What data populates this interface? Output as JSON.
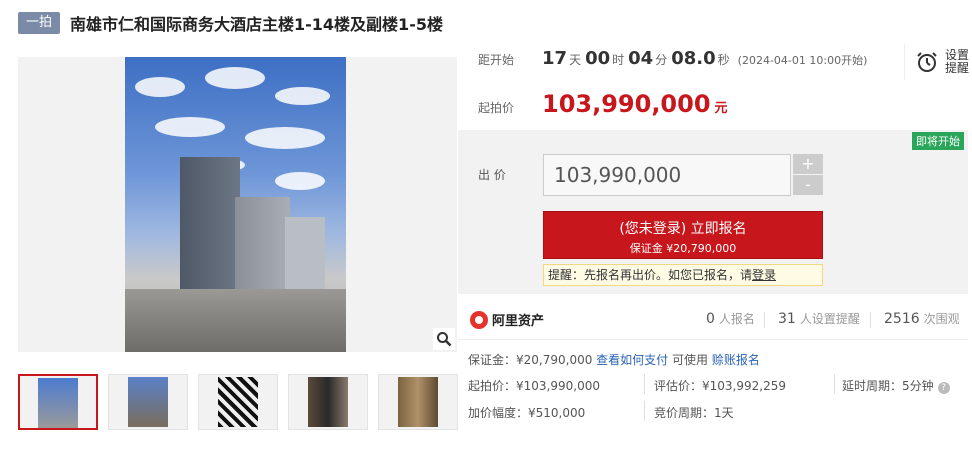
{
  "header": {
    "tag": "一拍",
    "title": "南雄市仁和国际商务大酒店主楼1-14楼及副楼1-5楼"
  },
  "countdown": {
    "label": "距开始",
    "days": "17",
    "days_unit": "天",
    "hours": "00",
    "hours_unit": "时",
    "minutes": "04",
    "minutes_unit": "分",
    "seconds": "08.0",
    "seconds_unit": "秒",
    "start_note": "(2024-04-01 10:00开始)"
  },
  "remind": {
    "label": "设置提醒",
    "icon": "alarm-clock-icon"
  },
  "start_price": {
    "label": "起拍价",
    "value": "103,990,000",
    "unit": "元"
  },
  "bid": {
    "status_badge": "即将开始",
    "label": "出 价",
    "input_value": "103,990,000",
    "plus": "+",
    "minus": "-",
    "register_main": "(您未登录) 立即报名",
    "register_sub": "保证金 ¥20,790,000",
    "tip_prefix": "提醒：先报名再出价。如您已报名，请",
    "tip_link": "登录"
  },
  "stats": {
    "brand": "阿里资产",
    "signups": "0",
    "signups_label": "人报名",
    "reminders": "31",
    "reminders_label": "人设置提醒",
    "views": "2516",
    "views_label": "次围观"
  },
  "details": {
    "deposit": "保证金：¥20,790,000",
    "how_to_pay": "查看如何支付",
    "can_use": "可使用",
    "credit_signup": "赊账报名",
    "start_price": "起拍价：¥103,990,000",
    "assessed": "评估价：¥103,992,259",
    "delay": "延时周期：5分钟",
    "increment": "加价幅度：¥510,000",
    "bid_cycle": "竞价周期：1天"
  },
  "colors": {
    "accent": "#c8161d",
    "tag": "#7b8aa6",
    "badge": "#2aa65a",
    "link": "#2a63b4"
  }
}
